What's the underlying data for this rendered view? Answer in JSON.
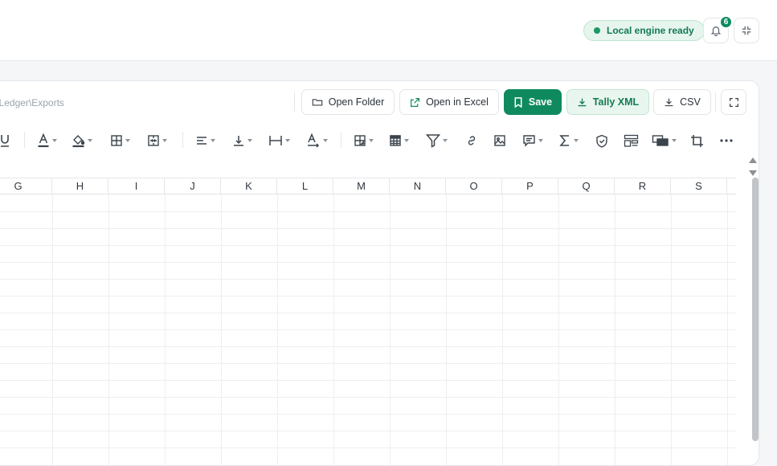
{
  "header": {
    "engine_status": "Local engine ready",
    "notification_count": "6"
  },
  "toolbar": {
    "path": "TruLedger\\Exports",
    "open_folder": "Open Folder",
    "open_in_excel": "Open in Excel",
    "save": "Save",
    "tally_xml": "Tally XML",
    "csv": "CSV"
  },
  "format_tools": [
    "underline",
    "font-color",
    "fill-color",
    "borders",
    "merge-cells",
    "align-horizontal",
    "align-vertical",
    "text-wrap",
    "text-rotate",
    "conditional-format",
    "table-format",
    "filter",
    "link",
    "image",
    "comment",
    "sum",
    "protect",
    "layout",
    "shapes",
    "crop",
    "more"
  ],
  "grid": {
    "columns": [
      "G",
      "H",
      "I",
      "J",
      "K",
      "L",
      "M",
      "N",
      "O",
      "P",
      "Q",
      "R",
      "S"
    ]
  },
  "colors": {
    "accent": "#0f8a5f",
    "accent_soft": "#e9f6ef"
  }
}
